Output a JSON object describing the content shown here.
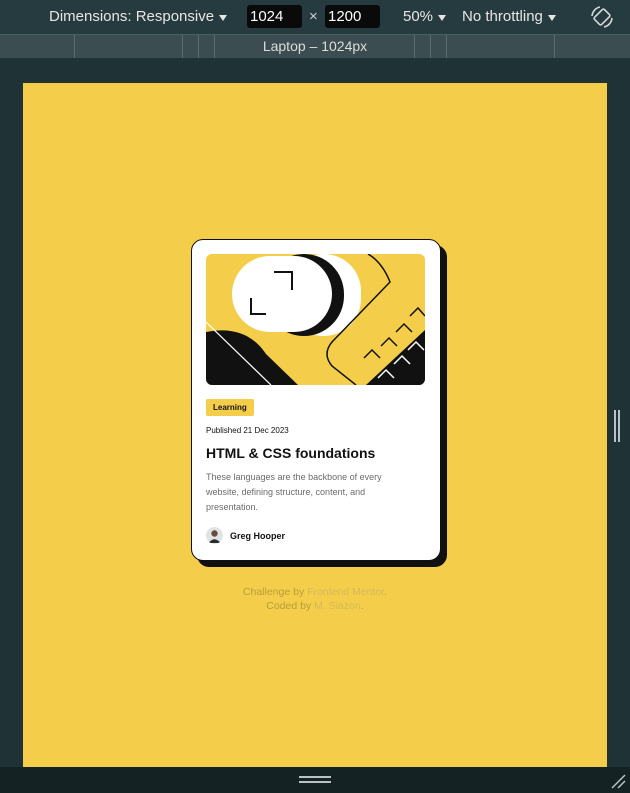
{
  "toolbar": {
    "dimensions_label": "Dimensions: Responsive",
    "width_value": "1024",
    "height_value": "1200",
    "times_symbol": "×",
    "zoom_label": "50%",
    "throttle_label": "No throttling"
  },
  "mediabar": {
    "label": "Laptop – 1024px"
  },
  "card": {
    "tag": "Learning",
    "published": "Published 21 Dec 2023",
    "title": "HTML & CSS foundations",
    "description": "These languages are the backbone of every website, defining structure, content, and presentation.",
    "author": "Greg Hooper"
  },
  "attribution": {
    "prefix1": "Challenge by ",
    "link1": "Frontend Mentor",
    "suffix1": ".",
    "prefix2": "Coded by ",
    "link2": "M. Siazon",
    "suffix2": "."
  },
  "colors": {
    "viewport_bg": "#f4ce4a",
    "card_bg": "#ffffff",
    "shadow": "#111111"
  }
}
